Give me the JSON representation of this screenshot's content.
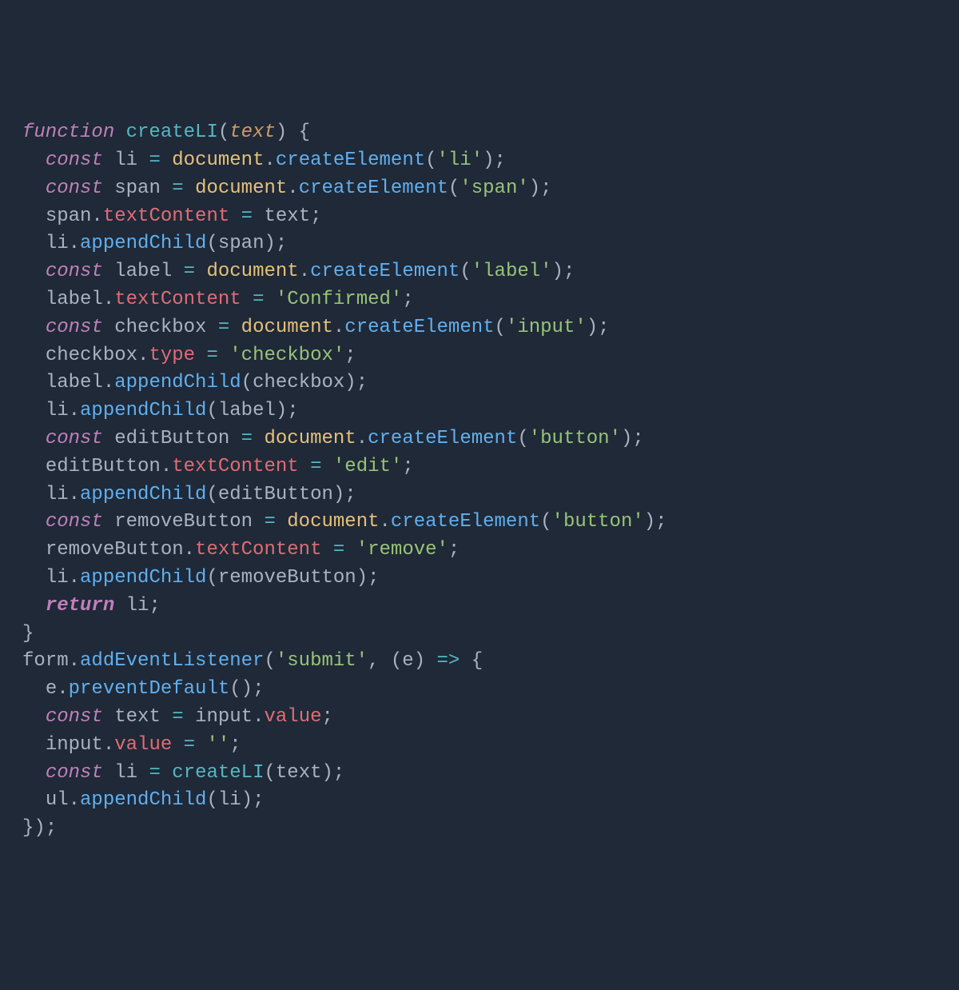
{
  "code": {
    "kw_function": "function",
    "kw_const": "const",
    "kw_return": "return",
    "fn_createLI": "createLI",
    "param_text": "text",
    "id_li": "li",
    "id_span": "span",
    "id_label": "label",
    "id_checkbox": "checkbox",
    "id_editButton": "editButton",
    "id_removeButton": "removeButton",
    "id_document": "document",
    "id_form": "form",
    "id_e": "e",
    "id_text": "text",
    "id_input": "input",
    "id_ul": "ul",
    "m_createElement": "createElement",
    "m_appendChild": "appendChild",
    "m_addEventListener": "addEventListener",
    "m_preventDefault": "preventDefault",
    "p_textContent": "textContent",
    "p_type": "type",
    "p_value": "value",
    "s_li": "'li'",
    "s_span": "'span'",
    "s_label": "'label'",
    "s_Confirmed": "'Confirmed'",
    "s_input": "'input'",
    "s_checkbox": "'checkbox'",
    "s_button": "'button'",
    "s_edit": "'edit'",
    "s_remove": "'remove'",
    "s_submit": "'submit'",
    "s_empty": "''",
    "op_eq": "=",
    "op_arrow": "=>",
    "p_open": "(",
    "p_close": ")",
    "b_open": "{",
    "b_close": "}",
    "semi": ";",
    "dot": ".",
    "comma": ","
  }
}
